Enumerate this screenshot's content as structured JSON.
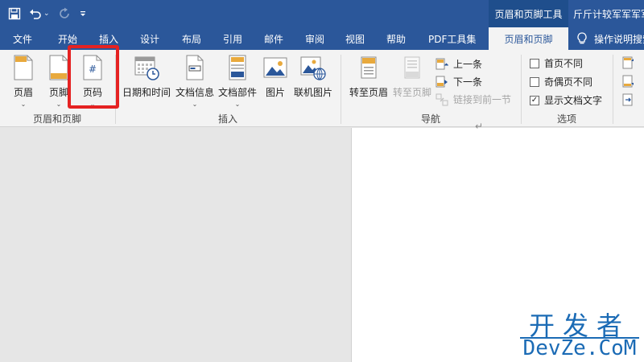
{
  "titlebar": {
    "contextual_tab_title": "页眉和页脚工具",
    "doc_title": "斤斤计较军军军军"
  },
  "tabs": [
    {
      "label": "文件"
    },
    {
      "label": "开始"
    },
    {
      "label": "插入"
    },
    {
      "label": "设计"
    },
    {
      "label": "布局"
    },
    {
      "label": "引用"
    },
    {
      "label": "邮件"
    },
    {
      "label": "审阅"
    },
    {
      "label": "视图"
    },
    {
      "label": "帮助"
    },
    {
      "label": "PDF工具集"
    },
    {
      "label": "页眉和页脚",
      "active": true
    }
  ],
  "tell_me": "操作说明搜索",
  "ribbon": {
    "group_header_footer": {
      "label": "页眉和页脚",
      "header": "页眉",
      "footer": "页脚",
      "page_number": "页码",
      "page_number_glyph": "#"
    },
    "group_insert": {
      "label": "插入",
      "date_time": "日期和时间",
      "doc_info": "文档信息",
      "doc_parts": "文档部件",
      "picture": "图片",
      "online_picture": "联机图片"
    },
    "group_navigation": {
      "label": "导航",
      "goto_header": "转至页眉",
      "goto_footer": "转至页脚",
      "prev": "上一条",
      "next": "下一条",
      "link_prev": "链接到前一节"
    },
    "group_options": {
      "label": "选项",
      "first_page": "首页不同",
      "odd_even": "奇偶页不同",
      "show_text": "显示文档文字",
      "show_text_checked": true
    }
  },
  "document": {
    "paragraph_mark": "↵"
  },
  "watermark": {
    "top": "开发者",
    "bottom": "DevZe.CoM"
  },
  "colors": {
    "accent": "#2b579a",
    "highlight": "#e52222",
    "watermark": "#1b6bb5"
  }
}
